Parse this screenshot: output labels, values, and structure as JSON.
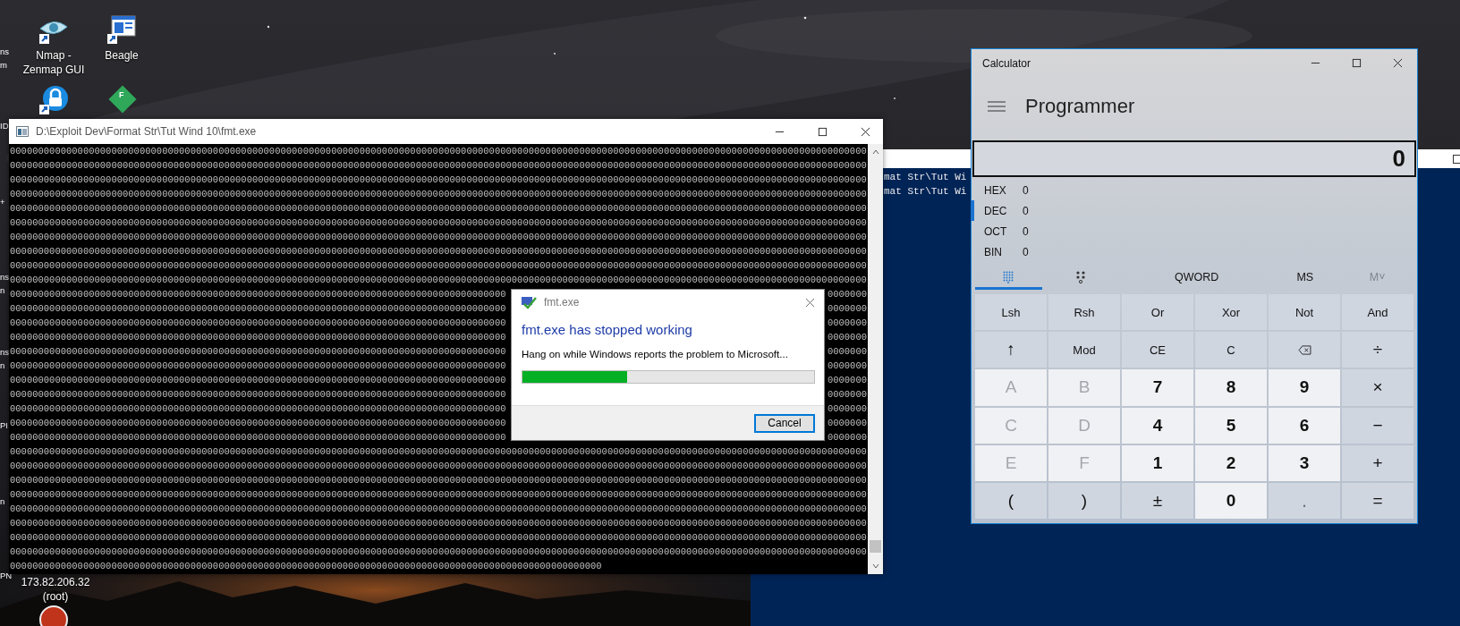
{
  "desktop_icons": [
    {
      "kind": "eye",
      "label": "Nmap - Zenmap GUI"
    },
    {
      "kind": "document",
      "label": "Beagle"
    },
    {
      "kind": "lock"
    },
    {
      "kind": "diamond",
      "glyph": "F"
    },
    {
      "kind": "red-circle"
    }
  ],
  "edge_labels": [
    {
      "lines": [
        "ns",
        "m"
      ]
    },
    {
      "lines": [
        "ID"
      ]
    },
    {
      "lines": [
        "+"
      ]
    },
    {
      "lines": [
        "ns",
        "n"
      ]
    },
    {
      "lines": [
        "ns",
        "n"
      ]
    },
    {
      "lines": [
        "PI"
      ]
    },
    {
      "lines": [
        "n"
      ]
    },
    {
      "lines": [
        "PN"
      ]
    }
  ],
  "host_label": {
    "lines": [
      "173.82.206.32",
      "(root)"
    ]
  },
  "background_window": {
    "lines": [
      "mat Str\\Tut Wi",
      "mat Str\\Tut Wi"
    ]
  },
  "console": {
    "title": "D:\\Exploit Dev\\Format Str\\Tut Wind 10\\fmt.exe",
    "lines": [
      {
        "text": "00000000000000000000000000000000000000000000000000000000000000000000000000000000000000000000000000000000000000000000000000000000000000000000000000000000"
      },
      {
        "text": "00000000000000000000000000000000000000000000000000000000000000000000000000000000000000000000000000000000000000000000000000000000000000000000000000000000"
      },
      {
        "text": "00000000000000000000000000000000000000000000000000000000000000000000000000000000000000000000000000000000000000000000000000000000000000000000000000000000"
      },
      {
        "text": "00000000000000000000000000000000000000000000000000000000000000000000000000000000000000000000000000000000000000000000000000000000000000000000000000000000"
      },
      {
        "text": "00000000000000000000000000000000000000000000000000000000000000000000000000000000000000000000000000000000000000000000000000000000000000000000000000000000"
      },
      {
        "text": "00000000000000000000000000000000000000000000000000000000000000000000000000000000000000000000000000000000000000000000000000000000000000000000000000000000"
      },
      {
        "text": "00000000000000000000000000000000000000000000000000000000000000000000000000000000000000000000000000000000000000000000000000000000000000000000000000000000"
      },
      {
        "text": "00000000000000000000000000000000000000000000000000000000000000000000000000000000000000000000000000000000000000000000000000000000000000000000000000000000"
      },
      {
        "text": "00000000000000000000000000000000000000000000000000000000000000000000000000000000000000000000000000000000000000000000000000000000000000000000000000000000"
      },
      {
        "text": "00000000000000000000000000000000000000000000000000000000000000000000000000000000000000000000000000000000000000000000000000000000000000000000000000000000"
      },
      {
        "text": "0000000000000000000000000000000000000000000000000000000000000000000000000000000000000000",
        "tail": "0000000"
      },
      {
        "text": "0000000000000000000000000000000000000000000000000000000000000000000000000000000000000000",
        "tail": "0000000"
      },
      {
        "text": "0000000000000000000000000000000000000000000000000000000000000000000000000000000000000000",
        "tail": "0000000"
      },
      {
        "text": "0000000000000000000000000000000000000000000000000000000000000000000000000000000000000000",
        "tail": "0000000"
      },
      {
        "text": "0000000000000000000000000000000000000000000000000000000000000000000000000000000000000000",
        "tail": "0000000"
      },
      {
        "text": "0000000000000000000000000000000000000000000000000000000000000000000000000000000000000000",
        "tail": "0000000"
      },
      {
        "text": "0000000000000000000000000000000000000000000000000000000000000000000000000000000000000000",
        "tail": "0000000"
      },
      {
        "text": "0000000000000000000000000000000000000000000000000000000000000000000000000000000000000000",
        "tail": "0000000"
      },
      {
        "text": "0000000000000000000000000000000000000000000000000000000000000000000000000000000000000000",
        "tail": "0000000"
      },
      {
        "text": "0000000000000000000000000000000000000000000000000000000000000000000000000000000000000000",
        "tail": "0000000"
      },
      {
        "text": "0000000000000000000000000000000000000000000000000000000000000000000000000000000000000000",
        "tail": "0000000"
      },
      {
        "text": "00000000000000000000000000000000000000000000000000000000000000000000000000000000000000000000000000000000000000000000000000000000000000000000000000000000"
      },
      {
        "text": "00000000000000000000000000000000000000000000000000000000000000000000000000000000000000000000000000000000000000000000000000000000000000000000000000000000"
      },
      {
        "text": "00000000000000000000000000000000000000000000000000000000000000000000000000000000000000000000000000000000000000000000000000000000000000000000000000000000"
      },
      {
        "text": "00000000000000000000000000000000000000000000000000000000000000000000000000000000000000000000000000000000000000000000000000000000000000000000000000000000"
      },
      {
        "text": "00000000000000000000000000000000000000000000000000000000000000000000000000000000000000000000000000000000000000000000000000000000000000000000000000000000"
      },
      {
        "text": "00000000000000000000000000000000000000000000000000000000000000000000000000000000000000000000000000000000000000000000000000000000000000000000000000000000"
      },
      {
        "text": "00000000000000000000000000000000000000000000000000000000000000000000000000000000000000000000000000000000000000000000000000000000000000000000000000000000"
      },
      {
        "text": "00000000000000000000000000000000000000000000000000000000000000000000000000000000000000000000000000000000000000000000000000000000000000000000000000000000"
      },
      {
        "text": "000000000000000000000000000000000000000000000000000000000000000000000000000000000000000000000000000000000"
      }
    ]
  },
  "dialog": {
    "title": "fmt.exe",
    "heading": "fmt.exe has stopped working",
    "message": "Hang on while Windows reports the problem to Microsoft...",
    "progress": {
      "level": 0.36
    },
    "buttons": [
      {
        "label": "Cancel",
        "focused": true
      }
    ]
  },
  "calculator": {
    "title": "Calculator",
    "mode": "Programmer",
    "display": "0",
    "radix": [
      {
        "name": "HEX",
        "value": "0",
        "selected": false
      },
      {
        "name": "DEC",
        "value": "0",
        "selected": true
      },
      {
        "name": "OCT",
        "value": "0",
        "selected": false
      },
      {
        "name": "BIN",
        "value": "0",
        "selected": false
      }
    ],
    "tabs": [
      {
        "kind": "keypad",
        "selected": true
      },
      {
        "kind": "bits",
        "selected": false
      }
    ],
    "word_size": "QWORD",
    "memory": [
      {
        "label": "MS",
        "disabled": false
      },
      {
        "label": "M˅",
        "disabled": true
      }
    ],
    "keys": [
      {
        "label": "Lsh",
        "kind": "op",
        "disabled": false
      },
      {
        "label": "Rsh",
        "kind": "op",
        "disabled": false
      },
      {
        "label": "Or",
        "kind": "op",
        "disabled": false
      },
      {
        "label": "Xor",
        "kind": "op",
        "disabled": false
      },
      {
        "label": "Not",
        "kind": "op",
        "disabled": false
      },
      {
        "label": "And",
        "kind": "op",
        "disabled": false
      },
      {
        "label": "↑",
        "kind": "symbol",
        "disabled": false
      },
      {
        "label": "Mod",
        "kind": "op",
        "disabled": false
      },
      {
        "label": "CE",
        "kind": "op",
        "disabled": false
      },
      {
        "label": "C",
        "kind": "op",
        "disabled": false
      },
      {
        "kind": "backspace",
        "disabled": false
      },
      {
        "label": "÷",
        "kind": "symbol",
        "disabled": false
      },
      {
        "label": "A",
        "kind": "digit",
        "disabled": true
      },
      {
        "label": "B",
        "kind": "digit",
        "disabled": true
      },
      {
        "label": "7",
        "kind": "digit",
        "disabled": false
      },
      {
        "label": "8",
        "kind": "digit",
        "disabled": false
      },
      {
        "label": "9",
        "kind": "digit",
        "disabled": false
      },
      {
        "label": "×",
        "kind": "symbol",
        "disabled": false
      },
      {
        "label": "C",
        "kind": "digit",
        "disabled": true
      },
      {
        "label": "D",
        "kind": "digit",
        "disabled": true
      },
      {
        "label": "4",
        "kind": "digit",
        "disabled": false
      },
      {
        "label": "5",
        "kind": "digit",
        "disabled": false
      },
      {
        "label": "6",
        "kind": "digit",
        "disabled": false
      },
      {
        "label": "−",
        "kind": "symbol",
        "disabled": false
      },
      {
        "label": "E",
        "kind": "digit",
        "disabled": true
      },
      {
        "label": "F",
        "kind": "digit",
        "disabled": true
      },
      {
        "label": "1",
        "kind": "digit",
        "disabled": false
      },
      {
        "label": "2",
        "kind": "digit",
        "disabled": false
      },
      {
        "label": "3",
        "kind": "digit",
        "disabled": false
      },
      {
        "label": "+",
        "kind": "symbol",
        "disabled": false
      },
      {
        "label": "(",
        "kind": "symbol",
        "disabled": false
      },
      {
        "label": ")",
        "kind": "symbol",
        "disabled": false
      },
      {
        "label": "±",
        "kind": "symbol",
        "disabled": false
      },
      {
        "label": "0",
        "kind": "digit",
        "disabled": false
      },
      {
        "label": ".",
        "kind": "symbol",
        "disabled": true
      },
      {
        "label": "=",
        "kind": "symbol",
        "disabled": false
      }
    ]
  }
}
